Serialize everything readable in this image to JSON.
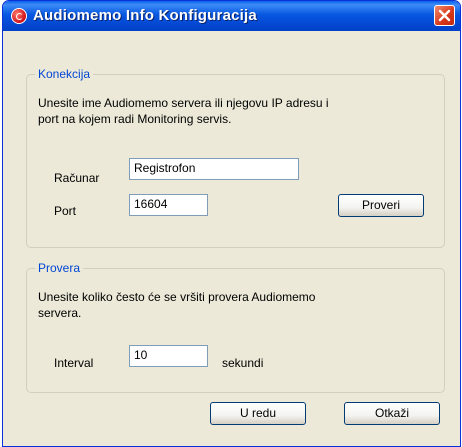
{
  "window": {
    "title": "Audiomemo Info Konfiguracija"
  },
  "konekcija": {
    "legend": "Konekcija",
    "description_line1": "Unesite ime Audiomemo servera ili njegovu IP adresu i",
    "description_line2": "port na kojem radi Monitoring servis.",
    "racunar_label": "Računar",
    "racunar_value": "Registrofon",
    "port_label": "Port",
    "port_value": "16604",
    "proveri_button": "Proveri"
  },
  "provera": {
    "legend": "Provera",
    "description_line1": "Unesite koliko često će se vršiti provera Audiomemo",
    "description_line2": "servera.",
    "interval_label": "Interval",
    "interval_value": "10",
    "unit_label": "sekundi"
  },
  "footer": {
    "ok_button": "U redu",
    "cancel_button": "Otkaži"
  },
  "colors": {
    "titlebar": "#0447d1",
    "group_legend": "#0046d5",
    "dialog_bg": "#ece9d8",
    "close_button": "#d8361a"
  },
  "icons": {
    "app": "audiomemo-app-icon",
    "close": "close-x-icon"
  }
}
